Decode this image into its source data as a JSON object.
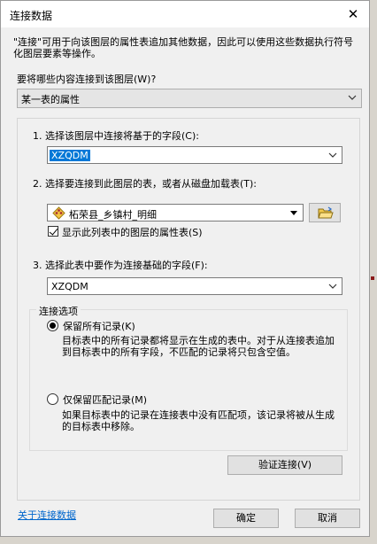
{
  "window": {
    "title": "连接数据",
    "close_glyph": "✕"
  },
  "intro_text": "\"连接\"可用于向该图层的属性表追加其他数据，因此可以使用这些数据执行符号化图层要素等操作。",
  "join_what": {
    "label": "要将哪些内容连接到该图层(W)?",
    "value": "某一表的属性"
  },
  "step1": {
    "label": "1.  选择该图层中连接将基于的字段(C):",
    "value": "XZQDM"
  },
  "step2": {
    "label": "2.  选择要连接到此图层的表，或者从磁盘加载表(T):",
    "value": "柘荣县_乡镇村_明细",
    "checkbox_label": "显示此列表中的图层的属性表(S)"
  },
  "step3": {
    "label": "3.  选择此表中要作为连接基础的字段(F):",
    "value": "XZQDM"
  },
  "options": {
    "legend": "连接选项",
    "keep_all_label": "保留所有记录(K)",
    "keep_all_desc": "目标表中的所有记录都将显示在生成的表中。对于从连接表追加到目标表中的所有字段，不匹配的记录将只包含空值。",
    "keep_matching_label": "仅保留匹配记录(M)",
    "keep_matching_desc": "如果目标表中的记录在连接表中没有匹配项，该记录将被从生成的目标表中移除。"
  },
  "validate_button": "验证连接(V)",
  "about_link": "关于连接数据",
  "ok_button": "确定",
  "cancel_button": "取消",
  "colors": {
    "selection": "#0078d7",
    "link": "#0066cc",
    "dialog_bg": "#f0f0f0"
  }
}
